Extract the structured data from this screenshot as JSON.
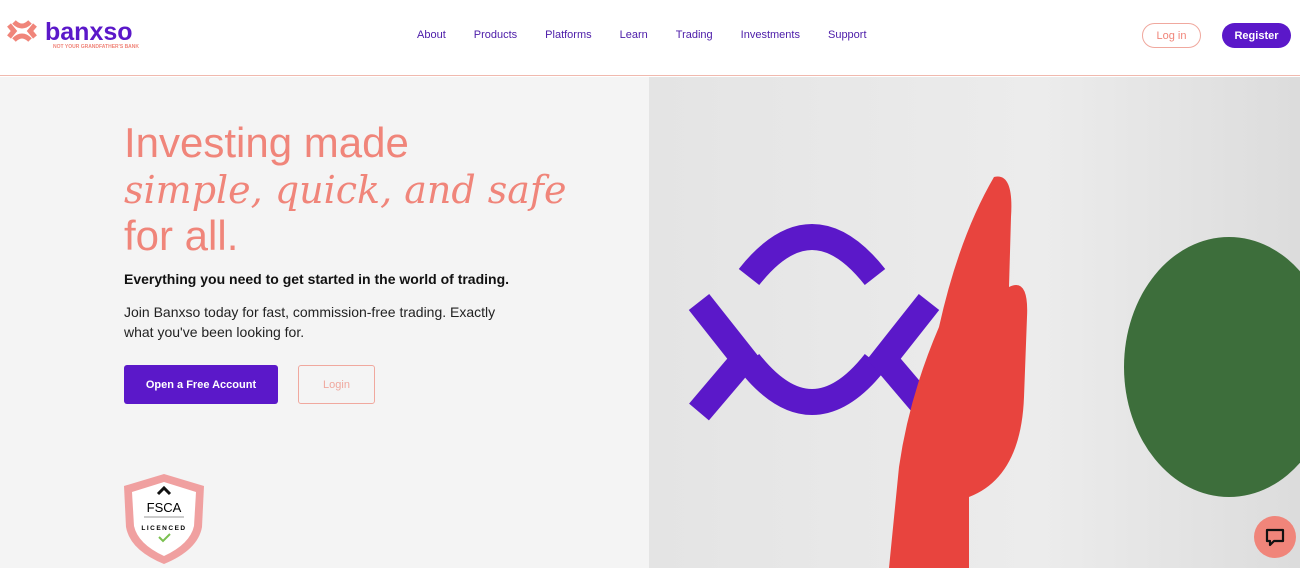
{
  "brand": {
    "name": "banxso",
    "tagline": "NOT YOUR GRANDFATHER'S BANK"
  },
  "nav": [
    "About",
    "Products",
    "Platforms",
    "Learn",
    "Trading",
    "Investments",
    "Support"
  ],
  "header": {
    "login": "Log in",
    "register": "Register"
  },
  "hero": {
    "line1": "Investing made",
    "line2": "simple, quick, and safe",
    "line3": "for all.",
    "subtitle": "Everything you need to get started in the world of trading.",
    "body": "Join Banxso today for fast, commission-free trading. Exactly what you've been looking for.",
    "cta": "Open a Free Account",
    "login": "Login"
  },
  "badge": {
    "title": "FSCA",
    "label": "LICENCED"
  },
  "colors": {
    "brand_purple": "#5b18c9",
    "coral": "#f0857a"
  }
}
